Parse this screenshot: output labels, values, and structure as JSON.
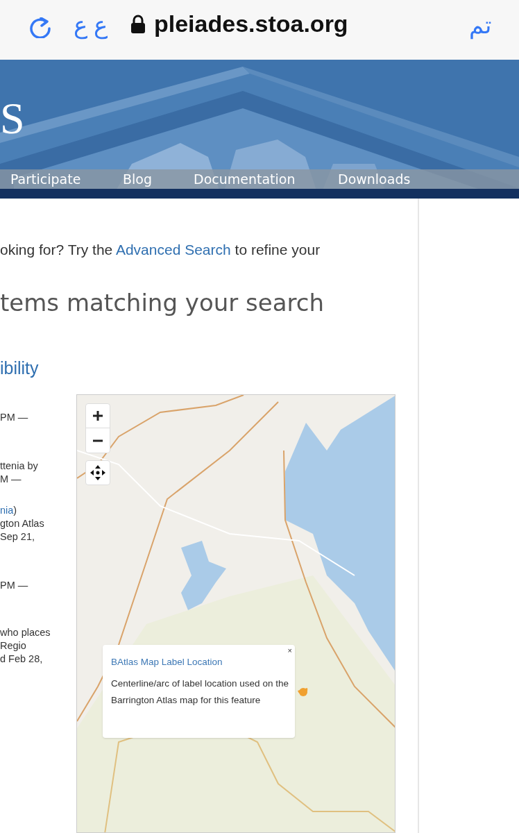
{
  "browser": {
    "reader_button": "ع ع",
    "url": "pleiades.stoa.org",
    "done_button": "تم"
  },
  "header": {
    "logo_letter": "S",
    "nav": [
      {
        "label": "Participate"
      },
      {
        "label": "Blog"
      },
      {
        "label": "Documentation"
      },
      {
        "label": "Downloads"
      }
    ]
  },
  "content": {
    "hint": [
      {
        "text": "oking for? Try the ",
        "link": false
      },
      {
        "text": "Advanced Search",
        "link": true
      },
      {
        "text": " to refine your",
        "link": false
      }
    ],
    "heading": "tems matching your search",
    "result_title": "ibility",
    "entries": [
      {
        "lines": [
          [
            {
              "text": "PM —",
              "link": false
            }
          ]
        ]
      },
      {
        "lines": [
          [
            {
              "text": "ttenia by",
              "link": false
            }
          ],
          [
            {
              "text": "M —",
              "link": false
            }
          ]
        ]
      },
      {
        "lines": [
          [
            {
              "text": "nia",
              "link": true
            },
            {
              "text": ")",
              "link": false
            }
          ],
          [
            {
              "text": "gton Atlas",
              "link": false
            }
          ],
          [
            {
              "text": "Sep 21,",
              "link": false
            }
          ]
        ]
      },
      {
        "lines": [
          [
            {
              "text": "PM —",
              "link": false
            }
          ]
        ]
      },
      {
        "lines": [
          [
            {
              "text": "who places",
              "link": false
            }
          ],
          [
            {
              "text": "Regio",
              "link": false
            }
          ],
          [
            {
              "text": "d Feb 28,",
              "link": false
            }
          ]
        ]
      }
    ]
  },
  "map": {
    "popup": {
      "title": "BAtlas Map Label Location",
      "text": "Centerline/arc of label location used on the Barrington Atlas map for this feature",
      "close": "×"
    }
  }
}
